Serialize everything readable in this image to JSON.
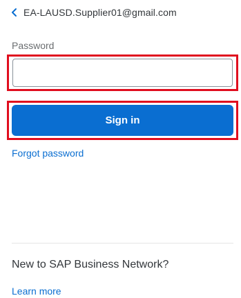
{
  "login": {
    "account_email": "EA-LAUSD.Supplier01@gmail.com",
    "back_icon": "chevron-left-icon",
    "password_label": "Password",
    "password_value": "",
    "signin_label": "Sign in",
    "forgot_label": "Forgot password"
  },
  "footer": {
    "question": "New to SAP Business Network?",
    "learn_more_label": "Learn more"
  },
  "colors": {
    "accent": "#0a6ed1",
    "highlight": "#e00d1e",
    "text": "#32363a"
  }
}
